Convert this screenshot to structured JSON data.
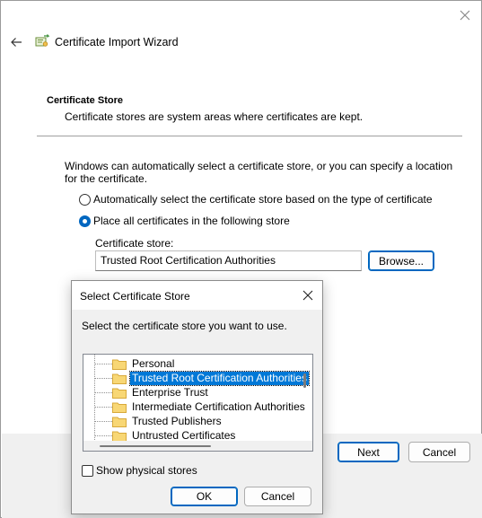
{
  "wizard": {
    "title": "Certificate Import Wizard",
    "section_title": "Certificate Store",
    "section_desc": "Certificate stores are system areas where certificates are kept.",
    "intro": "Windows can automatically select a certificate store, or you can specify a location for the certificate.",
    "radio_auto": "Automatically select the certificate store based on the type of certificate",
    "radio_place": "Place all certificates in the following store",
    "selected_option": "place",
    "store_label": "Certificate store:",
    "store_value": "Trusted Root Certification Authorities",
    "browse_label": "Browse...",
    "next_label": "Next",
    "cancel_label": "Cancel"
  },
  "dialog": {
    "title": "Select Certificate Store",
    "prompt": "Select the certificate store you want to use.",
    "stores": [
      "Personal",
      "Trusted Root Certification Authorities",
      "Enterprise Trust",
      "Intermediate Certification Authorities",
      "Trusted Publishers",
      "Untrusted Certificates"
    ],
    "selected_store": "Trusted Root Certification Authorities",
    "show_physical_label": "Show physical stores",
    "show_physical_checked": false,
    "ok_label": "OK",
    "cancel_label": "Cancel"
  },
  "icons": {
    "close": "close-icon",
    "back": "back-arrow-icon",
    "wizard": "certificate-wizard-icon",
    "folder": "folder-icon"
  },
  "colors": {
    "accent": "#0067c0",
    "selection": "#0078d7",
    "folder": "#f8d775",
    "footer": "#f0f0f0"
  }
}
